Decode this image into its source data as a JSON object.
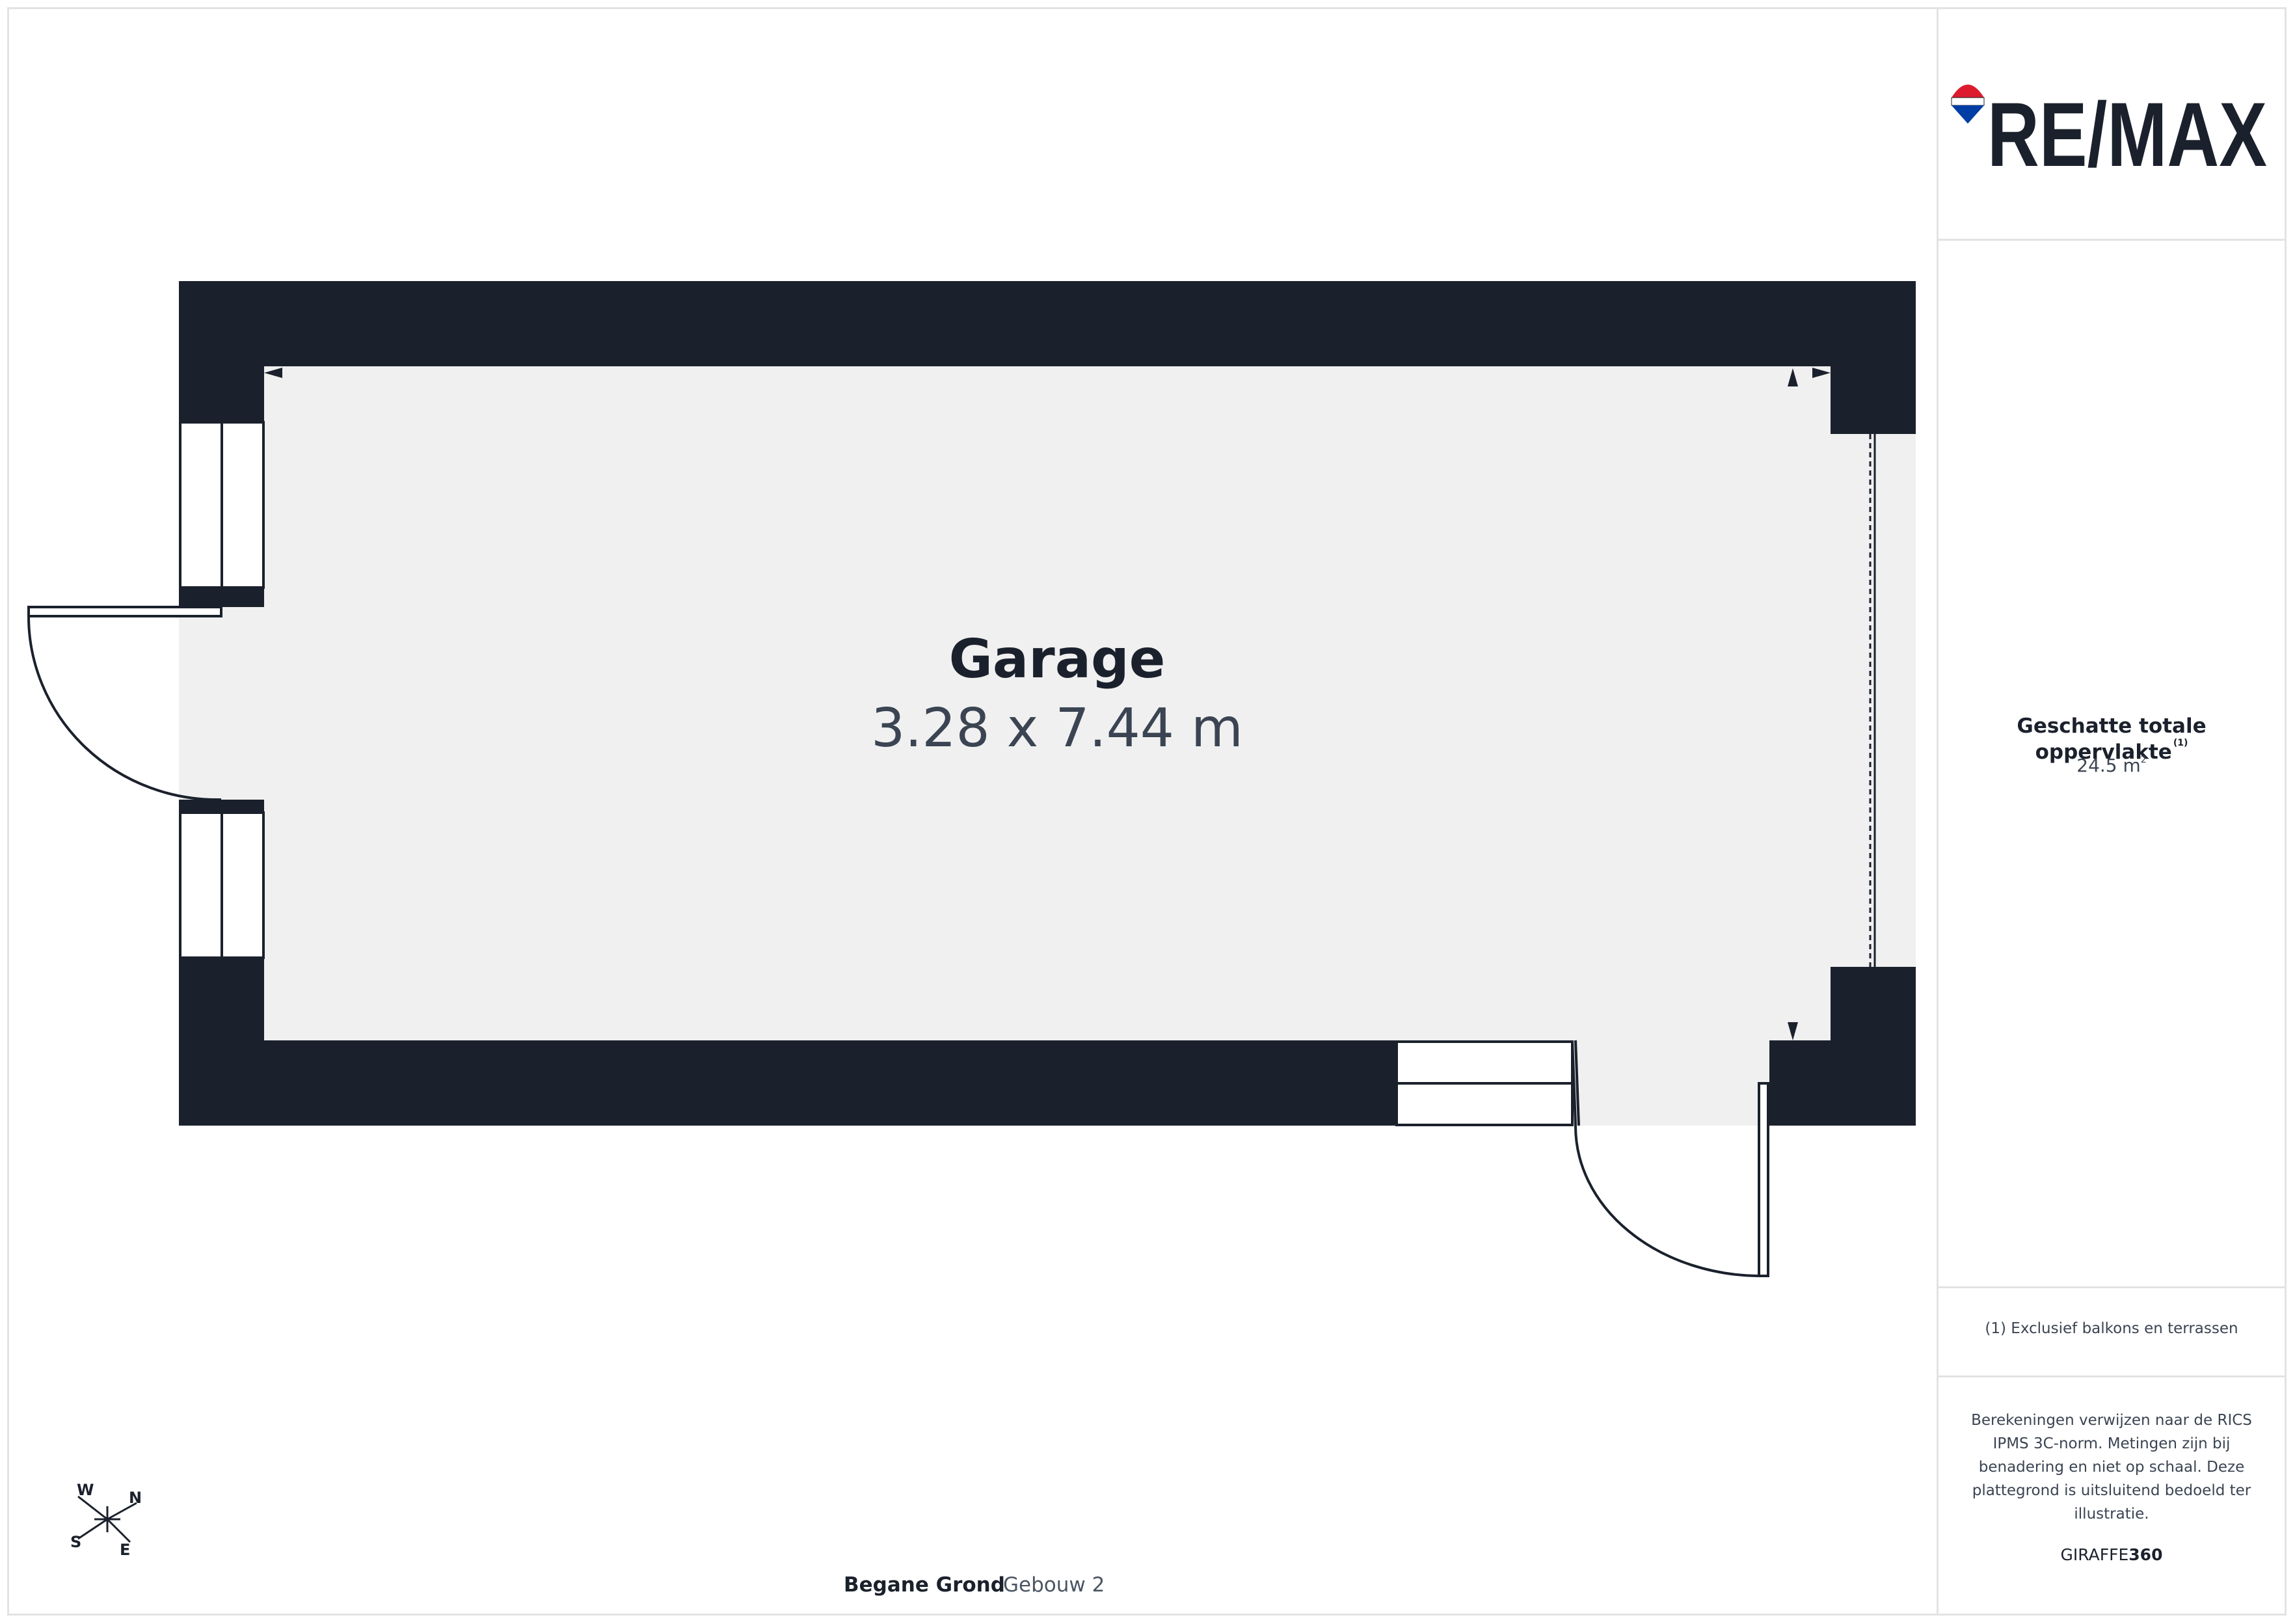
{
  "brand": {
    "logo_text": "RE/MAX",
    "colors": {
      "red": "#dc1c2e",
      "blue": "#003da5",
      "dark": "#1b212c"
    }
  },
  "room": {
    "name": "Garage",
    "dimensions": "3.28 x 7.44 m"
  },
  "area": {
    "title": "Geschatte totale oppervlakte",
    "footnote_mark": "(1)",
    "value": "24.5 m",
    "unit_sup": "2"
  },
  "footnote": "(1) Exclusief balkons en terrassen",
  "disclaimer": "Berekeningen verwijzen naar de RICS IPMS 3C-norm. Metingen zijn bij benadering en niet op schaal. Deze plattegrond is uitsluitend bedoeld ter illustratie.",
  "producer": {
    "prefix": "GIRAFFE",
    "suffix": "360"
  },
  "floor": {
    "name": "Begane Grond",
    "building": "Gebouw 2"
  },
  "compass": {
    "w": "W",
    "n": "N",
    "s": "S",
    "e": "E"
  },
  "colors": {
    "wall": "#1b212c",
    "floor": "#f0f0f0",
    "border": "#e3e3e3"
  }
}
